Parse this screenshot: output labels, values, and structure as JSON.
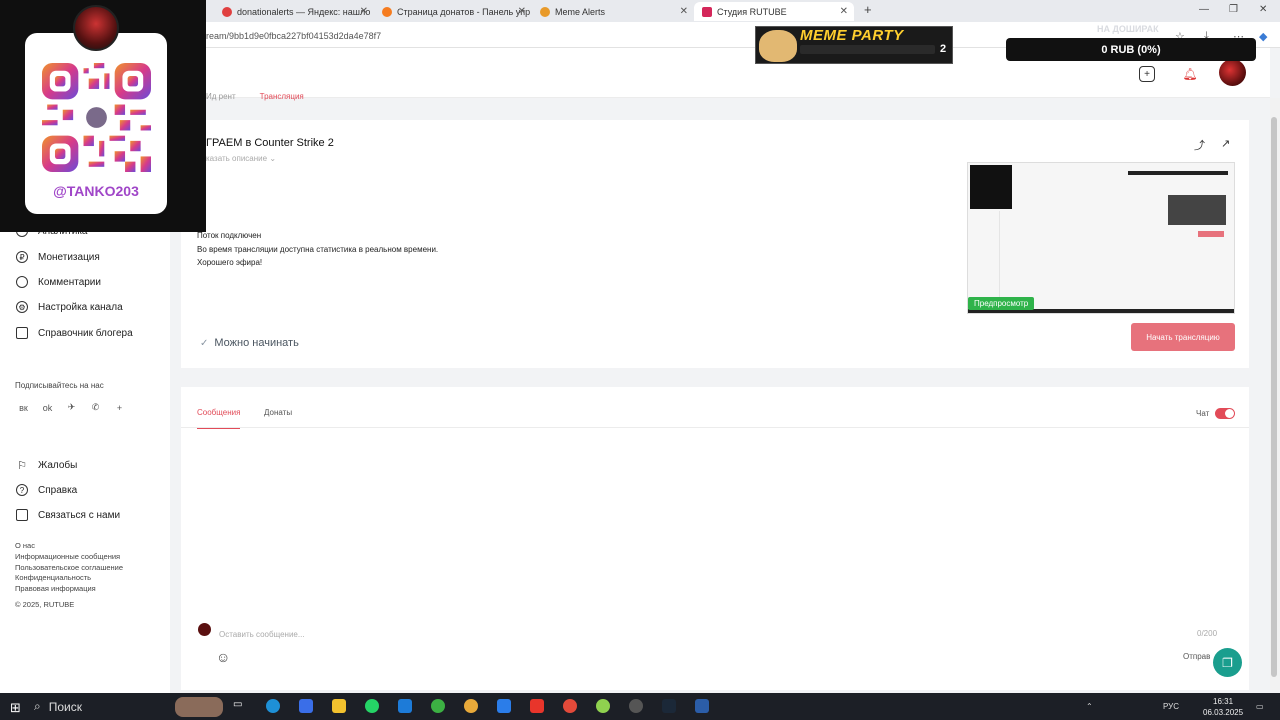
{
  "browser": {
    "tabs": [
      {
        "title": "donationalerts — Яндекс: нашло"
      },
      {
        "title": "Страница донатов - Панель упр"
      },
      {
        "title": "Meme Alerts"
      },
      {
        "title": "Студия RUTUBE"
      }
    ],
    "url": "ream/9bb1d9e0fbca227bf04153d2da4e78f7"
  },
  "header": {
    "tabs": [
      "Ид рент",
      "Трансляция"
    ]
  },
  "stream": {
    "title": "ГРАЕМ в Counter Strike 2",
    "show_description": "казать описание",
    "status_line1": "Поток подключен",
    "status_line2": "Во время трансляции доступна статистика в реальном времени.",
    "status_line3": "Хорошего эфира!",
    "ready": "Можно начинать",
    "preview_badge": "Предпросмотр",
    "start_button": "Начать трансляцию"
  },
  "sidebar": {
    "items": [
      {
        "label": "Аналитика"
      },
      {
        "label": "Монетизация"
      },
      {
        "label": "Комментарии"
      },
      {
        "label": "Настройка канала"
      },
      {
        "label": "Справочник блогера"
      }
    ],
    "subscribe_title": "Подписывайтесь на нас",
    "bottom_items": [
      {
        "label": "Жалобы"
      },
      {
        "label": "Справка"
      },
      {
        "label": "Связаться с нами"
      }
    ],
    "footer_links": [
      "О нас",
      "Информационные сообщения",
      "Пользовательское соглашение",
      "Конфиденциальность",
      "Правовая информация",
      "© 2025, RUTUBE"
    ]
  },
  "chat": {
    "tabs": [
      "Сообщения",
      "Донаты"
    ],
    "chat_label": "Чат",
    "placeholder": "Оставить сообщение...",
    "counter": "0/200",
    "send": "Отправ"
  },
  "overlay": {
    "handle": "@TANKO203",
    "meme_title": "MEME PARTY",
    "meme_count": "2",
    "donate_text": "0 RUB (0%)",
    "donate_ghost": "НА ДОШИРАК"
  },
  "taskbar": {
    "search": "Поиск",
    "lang": "РУС",
    "time": "16:31",
    "date": "06.03.2025"
  },
  "colors": {
    "accent": "#e24b58",
    "start_button": "#e7727c",
    "preview_badge": "#2fb34a",
    "help_bubble": "#1a9e8e"
  }
}
